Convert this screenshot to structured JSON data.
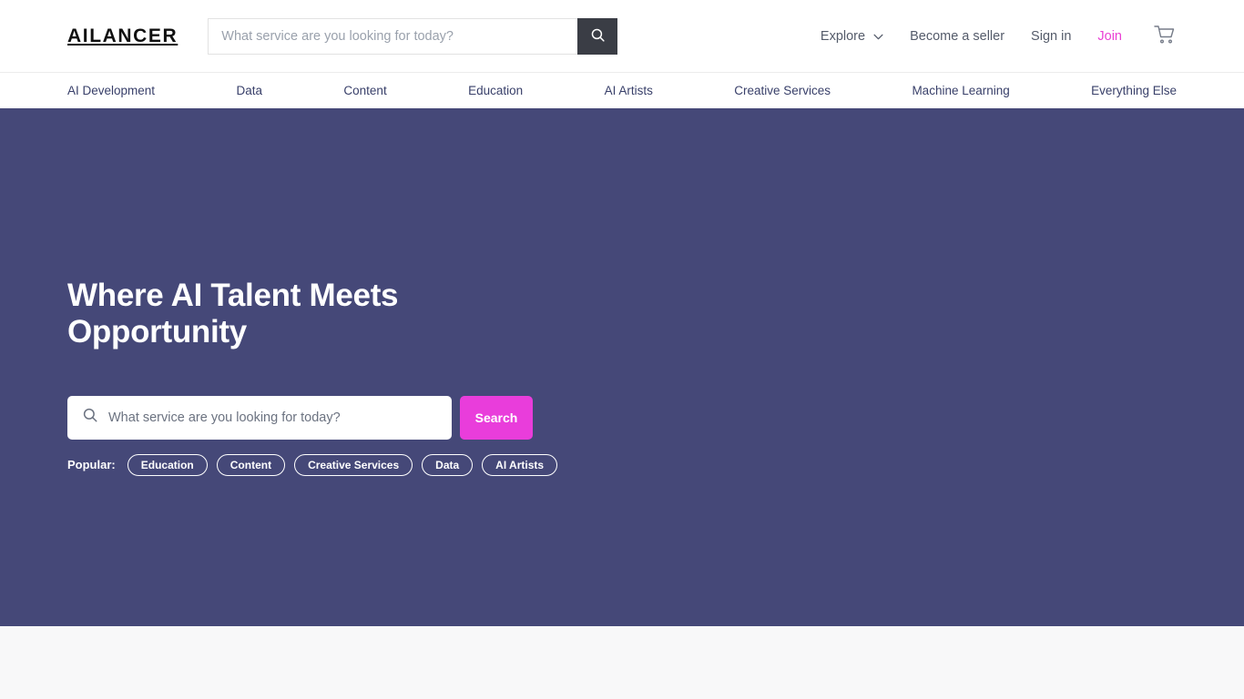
{
  "brand": {
    "logo": "AILANCER",
    "accent_pink": "#e93ddb",
    "hero_bg": "#454878",
    "header_search_btn_bg": "#3a3d45",
    "below_bg": "#f8f8f9"
  },
  "header": {
    "search": {
      "placeholder": "What service are you looking for today?",
      "value": "",
      "button_icon": "search-icon"
    },
    "nav": [
      {
        "label": "Explore",
        "icon": "chevron-down-icon",
        "accent": false
      },
      {
        "label": "Become a seller",
        "accent": false
      },
      {
        "label": "Sign in",
        "accent": false
      },
      {
        "label": "Join",
        "accent": true
      }
    ],
    "cart_icon": "shopping-cart-icon"
  },
  "categories": [
    {
      "label": "AI Development"
    },
    {
      "label": "Data"
    },
    {
      "label": "Content"
    },
    {
      "label": "Education"
    },
    {
      "label": "AI Artists"
    },
    {
      "label": "Creative Services"
    },
    {
      "label": "Machine Learning"
    },
    {
      "label": "Everything Else"
    }
  ],
  "hero": {
    "title": "Where AI Talent Meets Opportunity",
    "search": {
      "placeholder": "What service are you looking for today?",
      "value": "",
      "icon": "search-icon",
      "button_label": "Search"
    },
    "popular_label": "Popular:",
    "popular_tags": [
      {
        "label": "Education"
      },
      {
        "label": "Content"
      },
      {
        "label": "Creative Services"
      },
      {
        "label": "Data"
      },
      {
        "label": "AI Artists"
      }
    ]
  }
}
